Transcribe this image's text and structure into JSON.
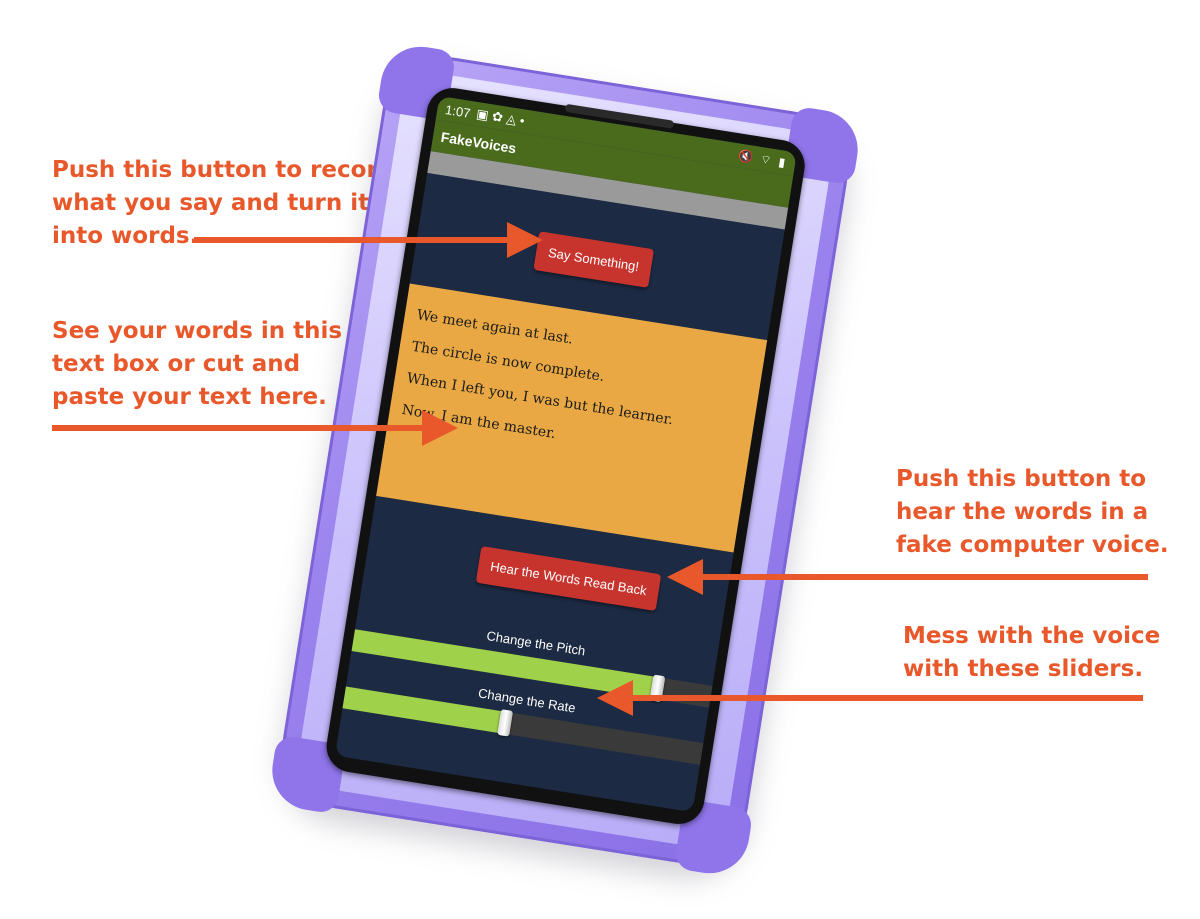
{
  "callouts": {
    "record": [
      "Push this button to record",
      "what you say and turn it",
      "into words."
    ],
    "textbox": [
      "See your words in this",
      "text box or cut and",
      "paste your text here."
    ],
    "hear": [
      "Push this button to",
      "hear the words in a",
      "fake computer voice."
    ],
    "sliders": [
      "Mess with the voice",
      "with these sliders."
    ]
  },
  "status_bar": {
    "time": "1:07",
    "left_icons": "▣ ✿ ◬ •",
    "right_icons": "🔇 ⌔ ▮"
  },
  "app": {
    "title": "FakeVoices",
    "say_button": "Say Something!",
    "text_lines": [
      "We meet again at last.",
      "The circle is now complete.",
      "When I left you, I was but the learner.",
      "Now, I am the master."
    ],
    "hear_button": "Hear the Words Read Back",
    "pitch_label": "Change the Pitch",
    "pitch_value": 0.85,
    "rate_label": "Change the Rate",
    "rate_value": 0.45
  },
  "colors": {
    "callout": "#e8582a",
    "case": "#9b83ee",
    "screen_bg": "#1c2a43",
    "appbar": "#4a6a1c",
    "button": "#c7342e",
    "textbox": "#e9a843",
    "slider_fill": "#9fd14a"
  }
}
